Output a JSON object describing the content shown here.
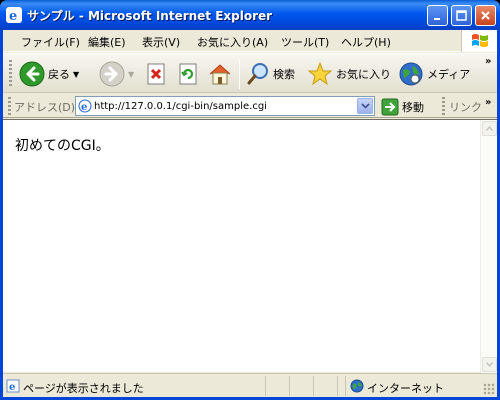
{
  "window": {
    "title": "サンプル - Microsoft Internet Explorer",
    "accent_color": "#0047d9"
  },
  "menu": {
    "items": [
      "ファイル(F)",
      "編集(E)",
      "表示(V)",
      "お気に入り(A)",
      "ツール(T)",
      "ヘルプ(H)"
    ]
  },
  "toolbar": {
    "back_label": "戻る",
    "search_label": "検索",
    "favorites_label": "お気に入り",
    "media_label": "メディア",
    "overflow": "»"
  },
  "address": {
    "label": "アドレス(D)",
    "url": "http://127.0.0.1/cgi-bin/sample.cgi",
    "go_label": "移動",
    "links_label": "リンク",
    "overflow": "»"
  },
  "content": {
    "text": "初めてのCGI。"
  },
  "status": {
    "text": "ページが表示されました",
    "zone": "インターネット"
  }
}
